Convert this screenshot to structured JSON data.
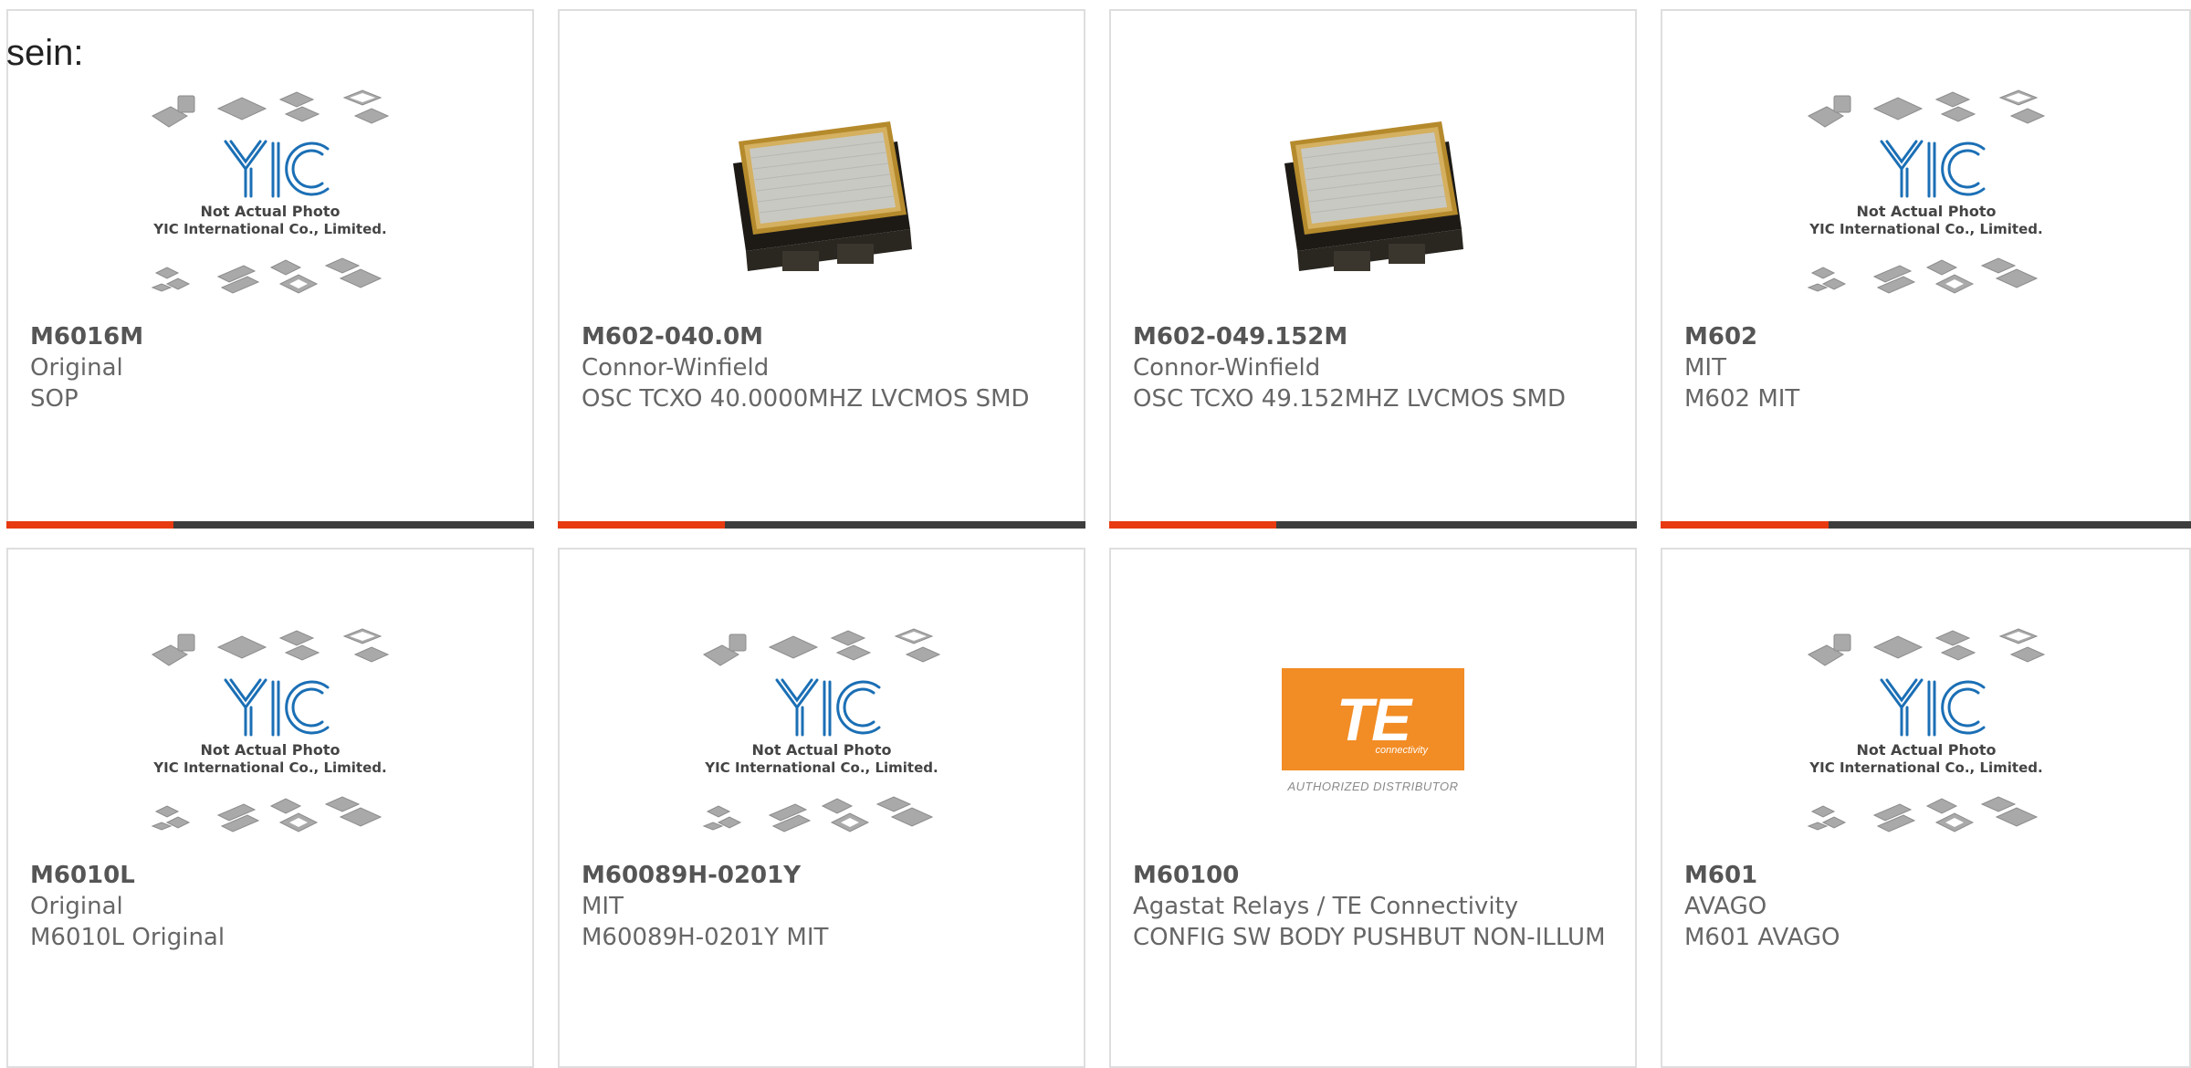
{
  "intro_text": "sein:",
  "placeholder_image": {
    "logo_text": "YIC",
    "caption_line1": "Not Actual Photo",
    "caption_line2": "YIC International Co., Limited."
  },
  "te_logo": {
    "text": "TE",
    "subtext": "connectivity",
    "distributor": "AUTHORIZED DISTRIBUTOR"
  },
  "products": [
    {
      "part_number": "M6016M",
      "manufacturer": "Original",
      "description": "SOP",
      "image": "placeholder"
    },
    {
      "part_number": "M602-040.0M",
      "manufacturer": "Connor-Winfield",
      "description": "OSC TCXO 40.0000MHZ LVCMOS SMD",
      "image": "crystal-oscillator"
    },
    {
      "part_number": "M602-049.152M",
      "manufacturer": "Connor-Winfield",
      "description": "OSC TCXO 49.152MHZ LVCMOS SMD",
      "image": "crystal-oscillator"
    },
    {
      "part_number": "M602",
      "manufacturer": "MIT",
      "description": "M602 MIT",
      "image": "placeholder"
    },
    {
      "part_number": "M6010L",
      "manufacturer": "Original",
      "description": "M6010L Original",
      "image": "placeholder"
    },
    {
      "part_number": "M60089H-0201Y",
      "manufacturer": "MIT",
      "description": "M60089H-0201Y MIT",
      "image": "placeholder"
    },
    {
      "part_number": "M60100",
      "manufacturer": "Agastat Relays / TE Connectivity",
      "description": "CONFIG SW BODY PUSHBUT NON-ILLUM",
      "image": "te-logo"
    },
    {
      "part_number": "M601",
      "manufacturer": "AVAGO",
      "description": "M601 AVAGO",
      "image": "placeholder"
    }
  ],
  "colors": {
    "accent": "#e83a10",
    "bar": "#3d3d3d",
    "border": "#dedede",
    "yic_blue": "#1b6fb5",
    "te_orange": "#f28c25"
  }
}
